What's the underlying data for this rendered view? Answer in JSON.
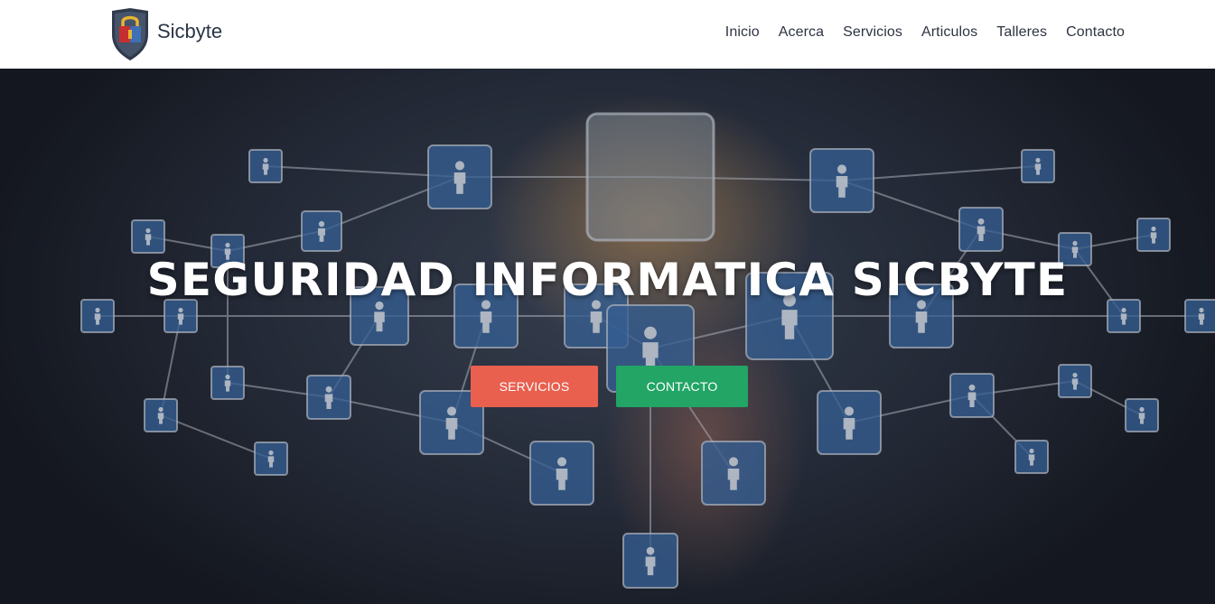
{
  "brand": {
    "name": "Sicbyte",
    "colors": {
      "shield_dark": "#2f3a4c",
      "lock_red": "#c62f2f",
      "lock_blue": "#3f6fb5",
      "lock_yellow": "#e7b332"
    }
  },
  "nav": {
    "items": [
      {
        "label": "Inicio"
      },
      {
        "label": "Acerca"
      },
      {
        "label": "Servicios"
      },
      {
        "label": "Articulos"
      },
      {
        "label": "Talleres"
      },
      {
        "label": "Contacto"
      }
    ]
  },
  "hero": {
    "background": "network-of-people-icons",
    "title": "SEGURIDAD INFORMATICA SICBYTE",
    "buttons": {
      "primary_label": "SERVICIOS",
      "secondary_label": "CONTACTO"
    },
    "colors": {
      "primary": "#e9604f",
      "secondary": "#22a565"
    }
  }
}
